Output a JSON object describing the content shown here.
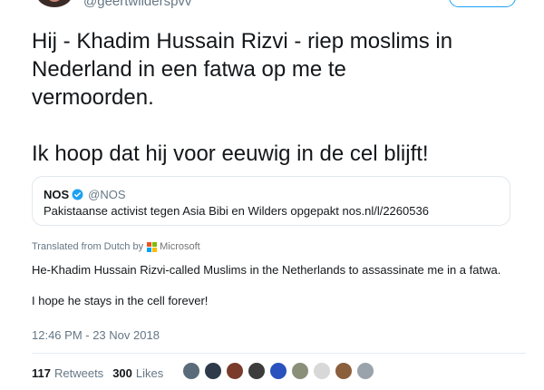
{
  "header": {
    "handle": "@geertwilderspvv"
  },
  "tweet": {
    "lines": [
      "Hij - Khadim Hussain Rizvi - riep moslims in",
      "Nederland in een fatwa op me te",
      "vermoorden.",
      "",
      "Ik hoop dat hij voor eeuwig in de cel blijft!"
    ]
  },
  "quote": {
    "name": "NOS",
    "handle": "@NOS",
    "text": "Pakistaanse activist tegen Asia Bibi en Wilders opgepakt  nos.nl/l/2260536"
  },
  "translation": {
    "label": "Translated from Dutch by",
    "provider": "Microsoft",
    "line1": "He-Khadim Hussain Rizvi-called Muslims in the Netherlands to assassinate me in a fatwa.",
    "line2": "I hope he stays in the cell forever!"
  },
  "timestamp": "12:46 PM - 23 Nov 2018",
  "stats": {
    "retweets_count": "117",
    "retweets_label": "Retweets",
    "likes_count": "300",
    "likes_label": "Likes"
  },
  "colors": {
    "accent": "#1da1f2",
    "muted": "#657786",
    "text": "#14171a",
    "ms_red": "#f25022",
    "ms_green": "#7fba00",
    "ms_blue": "#00a4ef",
    "ms_yellow": "#ffb900"
  },
  "liker_avatars": [
    "avatar-1",
    "avatar-2",
    "avatar-3",
    "avatar-4",
    "avatar-5",
    "avatar-6",
    "avatar-7",
    "avatar-8",
    "avatar-9"
  ]
}
